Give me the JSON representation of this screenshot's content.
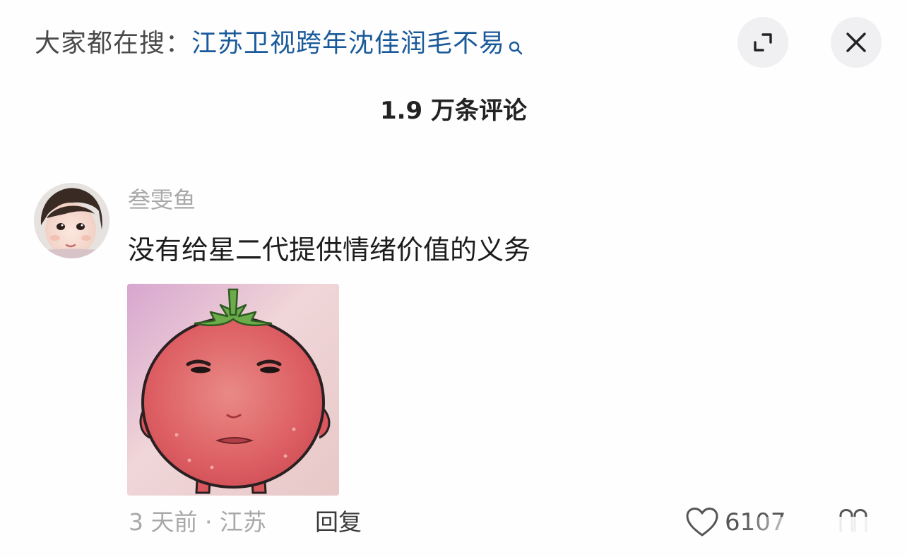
{
  "top_bar": {
    "prefix": "大家都在搜：",
    "query": "江苏卫视跨年沈佳润毛不易",
    "search_icon": "search-icon",
    "expand_icon": "expand-icon",
    "close_icon": "close-icon"
  },
  "comments_header": {
    "count_label": "1.9 万条评论"
  },
  "comment": {
    "username": "叁雯鱼",
    "text": "没有给星二代提供情绪价值的义务",
    "avatar": "avatar",
    "sticker": "tomato-face-sticker",
    "time_location": "3 天前 · 江苏",
    "reply_label": "回复",
    "like_icon": "heart-icon",
    "like_count": "6107",
    "more_icon": "more-icon"
  },
  "colors": {
    "query_link": "#1a5a9a",
    "muted_text": "#a8a8a8",
    "button_bg": "#f0f0f2",
    "sticker_face": "#e0565e",
    "sticker_leaf": "#6bab4a"
  }
}
